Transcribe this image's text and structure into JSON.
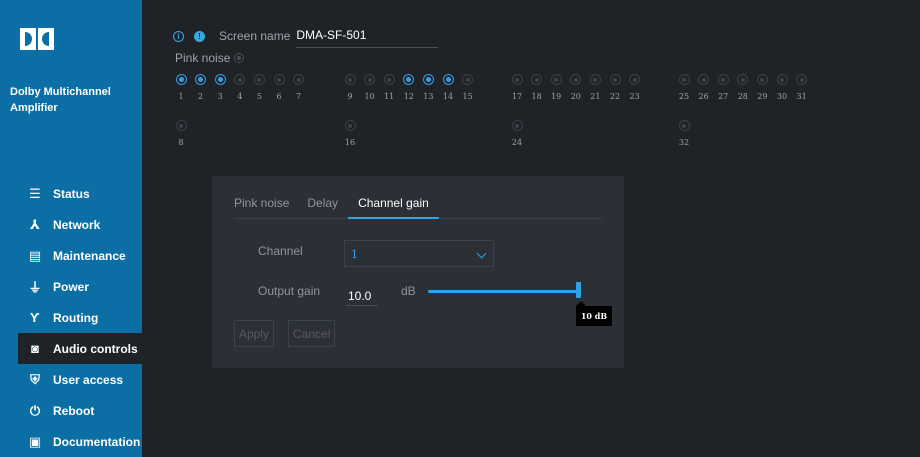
{
  "sidebar": {
    "product_name": "Dolby Multichannel Amplifier",
    "items": [
      {
        "label": "Status",
        "icon": "status-icon",
        "glyph": "☰"
      },
      {
        "label": "Network",
        "icon": "network-icon",
        "glyph": "⅄"
      },
      {
        "label": "Maintenance",
        "icon": "maintenance-icon",
        "glyph": "▤"
      },
      {
        "label": "Power",
        "icon": "power-plug-icon",
        "glyph": "⏚"
      },
      {
        "label": "Routing",
        "icon": "routing-icon",
        "glyph": "Ƴ"
      },
      {
        "label": "Audio controls",
        "icon": "speaker-icon",
        "glyph": "◙",
        "active": true
      },
      {
        "label": "User access",
        "icon": "shield-icon",
        "glyph": "⛨"
      },
      {
        "label": "Reboot",
        "icon": "reboot-icon",
        "glyph": "⏻"
      },
      {
        "label": "Documentation",
        "icon": "documentation-icon",
        "glyph": "▣"
      }
    ]
  },
  "header": {
    "screen_name_label": "Screen name",
    "screen_name_value": "DMA-SF-501"
  },
  "pink_noise": {
    "label": "Pink noise",
    "channels_row1": [
      "1",
      "2",
      "3",
      "4",
      "5",
      "6",
      "7",
      "9",
      "10",
      "11",
      "12",
      "13",
      "14",
      "15",
      "17",
      "18",
      "19",
      "20",
      "21",
      "22",
      "23",
      "25",
      "26",
      "27",
      "28",
      "29",
      "30",
      "31"
    ],
    "channels_row2": [
      "8",
      "16",
      "24",
      "32"
    ],
    "selected": [
      "1",
      "2",
      "3",
      "12",
      "13",
      "14"
    ]
  },
  "panel": {
    "tabs": [
      {
        "label": "Pink noise",
        "active": false
      },
      {
        "label": "Delay",
        "active": false
      },
      {
        "label": "Channel gain",
        "active": true
      }
    ],
    "channel_label": "Channel",
    "channel_value": "1",
    "output_gain_label": "Output gain",
    "output_gain_value": "10.0",
    "unit": "dB",
    "slider_level": 1.0,
    "slider_tooltip": "10 dB",
    "apply_label": "Apply",
    "cancel_label": "Cancel"
  },
  "colors": {
    "accent": "#2fa3e6",
    "sidebar": "#0b6fa6",
    "background": "#1f2226",
    "panel": "#2b3036"
  }
}
